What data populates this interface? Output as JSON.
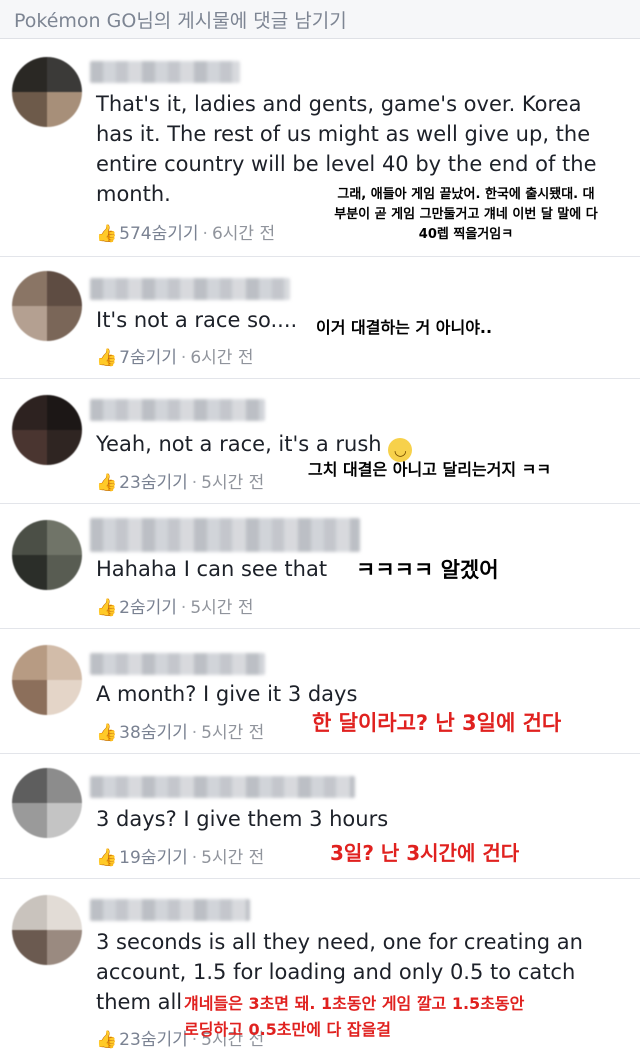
{
  "header": {
    "title": "Pokémon GO님의 게시물에 댓글 남기기"
  },
  "comments": [
    {
      "text": "That's it, ladies and gents, game's over. Korea\nhas it. The rest of us might as well give up, the\nentire country will be level 40 by the end of the\nmonth.",
      "likes": "574",
      "hide": "숨기기",
      "time": "6시간 전",
      "translation": "그래, 애들아 게임 끝났어. 한국에 출시됐대. 대\n부분이 곧 게임 그만둘거고 걔네 이번 달 말에 다\n40렙 찍을거임ㅋ"
    },
    {
      "text": "It's not a race so....",
      "likes": "7",
      "hide": "숨기기",
      "time": "6시간 전",
      "translation": "이거 대결하는 거 아니야.."
    },
    {
      "text": "Yeah, not a race, it's a rush",
      "likes": "23",
      "hide": "숨기기",
      "time": "5시간 전",
      "translation": "그치 대결은 아니고 달리는거지 ㅋㅋ"
    },
    {
      "text": "Hahaha I can see that",
      "likes": "2",
      "hide": "숨기기",
      "time": "5시간 전",
      "translation": "ㅋㅋㅋㅋ 알겠어"
    },
    {
      "text": "A month? I give it 3 days",
      "likes": "38",
      "hide": "숨기기",
      "time": "5시간 전",
      "translation": "한 달이라고? 난 3일에 건다"
    },
    {
      "text": "3 days? I give them 3 hours",
      "likes": "19",
      "hide": "숨기기",
      "time": "5시간 전",
      "translation": "3일? 난 3시간에 건다"
    },
    {
      "text": "3 seconds is all they need, one for creating an\naccount, 1.5 for loading and only 0.5 to catch\nthem all",
      "likes": "23",
      "hide": "숨기기",
      "time": "5시간 전",
      "translation": "걔네들은 3초면 돼. 1초동안 게임 깔고 1.5초동안\n로딩하고 0.5초만에 다 잡을걸"
    }
  ],
  "colors": {
    "red_translation": "#e0211f",
    "text": "#1d2129",
    "meta": "#90949c"
  },
  "icons": {
    "like": "thumbs-up-icon"
  }
}
